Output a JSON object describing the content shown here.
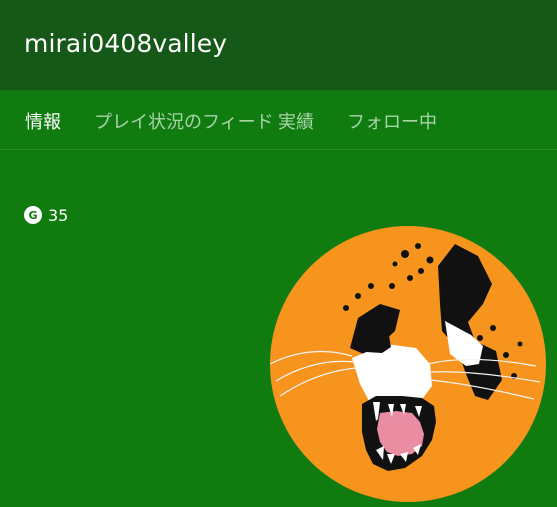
{
  "profile": {
    "gamertag": "mirai0408valley",
    "gamerscore_icon": "G",
    "gamerscore": "35"
  },
  "tabs": [
    {
      "label": "情報",
      "active": true
    },
    {
      "label": "プレイ状況のフィード",
      "active": false
    },
    {
      "label": "実績",
      "active": false
    },
    {
      "label": "フォロー中",
      "active": false
    }
  ],
  "avatar": {
    "icon": "cheetah-avatar",
    "background_color": "#f7941d"
  },
  "colors": {
    "header": "#165817",
    "page": "#107c10",
    "text": "#ffffff",
    "inactive_tab": "#a9d3a9"
  }
}
